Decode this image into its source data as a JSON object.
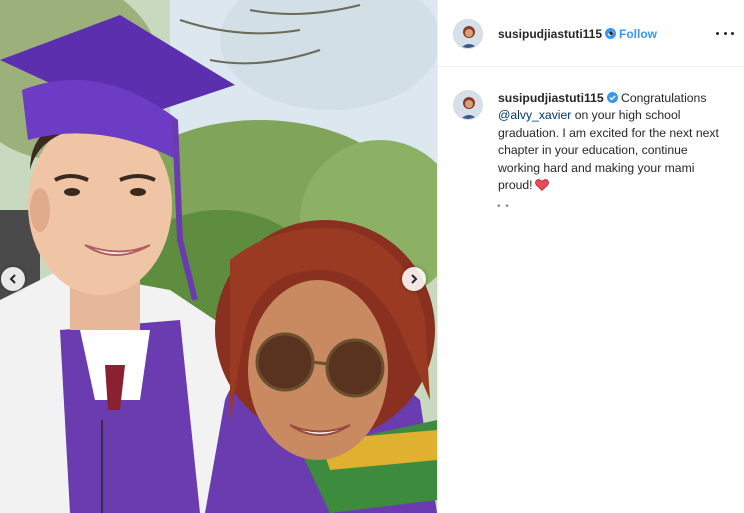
{
  "post": {
    "username": "susipudjiastuti115",
    "separator": "•",
    "follow_label": "Follow",
    "more_icon": "more-options-icon",
    "verified_icon": "verified-badge-icon"
  },
  "caption": {
    "username": "susipudjiastuti115",
    "text_before_mention": " Congratulations ",
    "mention": "@alvy_xavier",
    "text_after_mention": " on your high school graduation. I am excited for the next next chapter in your education, continue working hard and making your mami proud!",
    "emoji": "heart-emoji",
    "loading": "• •"
  },
  "media": {
    "prev_icon": "chevron-left-icon",
    "next_icon": "chevron-right-icon"
  },
  "colors": {
    "link": "#3897f0",
    "mention": "#00376b",
    "text": "#262626",
    "verified": "#3897f0",
    "heart": "#ed4956",
    "gown": "#6a3cb0"
  }
}
